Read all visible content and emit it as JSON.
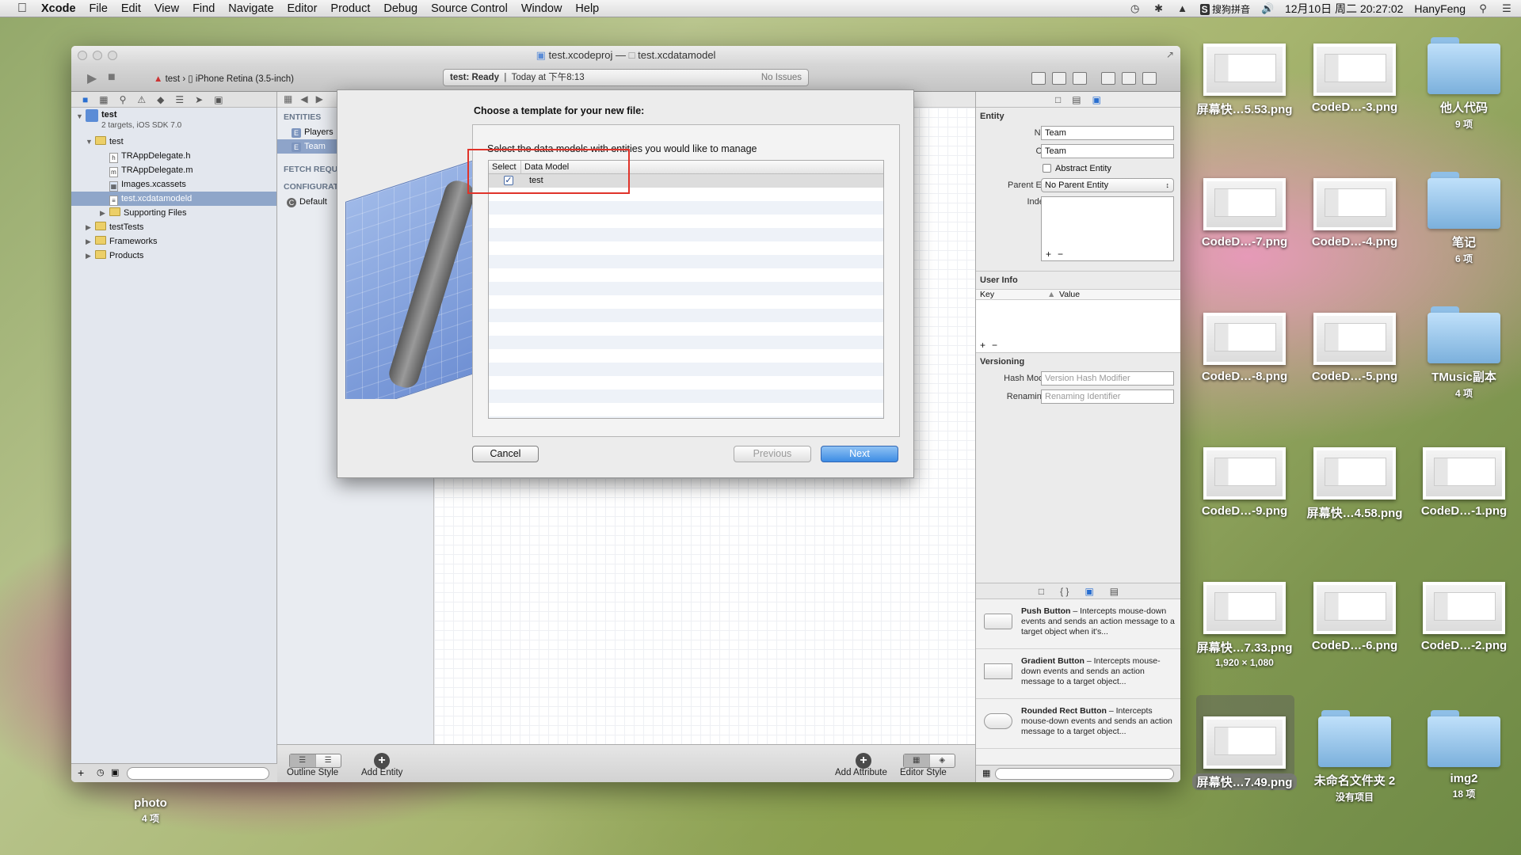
{
  "menubar": {
    "app": "Xcode",
    "items": [
      "File",
      "Edit",
      "View",
      "Find",
      "Navigate",
      "Editor",
      "Product",
      "Debug",
      "Source Control",
      "Window",
      "Help"
    ],
    "input_method": "搜狗拼音",
    "datetime": "12月10日 周二  20:27:02",
    "user": "HanyFeng"
  },
  "window": {
    "title_left": "test.xcodeproj",
    "title_sep": "—",
    "title_right": "test.xcdatamodel",
    "scheme": "test",
    "device": "iPhone Retina (3.5-inch)",
    "activity_status": "test: Ready",
    "activity_time": "Today at 下午8:13",
    "activity_issues": "No Issues"
  },
  "navigator": {
    "items": [
      {
        "label": "test",
        "sub": "2 targets, iOS SDK 7.0"
      },
      {
        "label": "test"
      },
      {
        "label": "TRAppDelegate.h"
      },
      {
        "label": "TRAppDelegate.m"
      },
      {
        "label": "Images.xcassets"
      },
      {
        "label": "test.xcdatamodeld"
      },
      {
        "label": "Supporting Files"
      },
      {
        "label": "testTests"
      },
      {
        "label": "Frameworks"
      },
      {
        "label": "Products"
      }
    ]
  },
  "outline": {
    "entities_header": "ENTITIES",
    "entities": [
      "Players",
      "Team"
    ],
    "fetch_header": "FETCH REQUESTS",
    "config_header": "CONFIGURATIONS",
    "configs": [
      "Default"
    ]
  },
  "editor_bottom": {
    "outline_style": "Outline Style",
    "add_entity": "Add Entity",
    "add_attribute": "Add Attribute",
    "editor_style": "Editor Style"
  },
  "sheet": {
    "title": "Choose a template for your new file:",
    "description": "Select the data models with entities you would like to manage",
    "col_select": "Select",
    "col_model": "Data Model",
    "rows": [
      {
        "model": "test",
        "checked": true
      }
    ],
    "cancel": "Cancel",
    "previous": "Previous",
    "next": "Next"
  },
  "inspector": {
    "entity_header": "Entity",
    "name_label": "Name",
    "name_value": "Team",
    "class_label": "Class",
    "class_value": "Team",
    "abstract_label": "Abstract Entity",
    "parent_label": "Parent Entity",
    "parent_value": "No Parent Entity",
    "indexes_label": "Indexes",
    "userinfo_header": "User Info",
    "key_col": "Key",
    "value_col": "Value",
    "versioning_header": "Versioning",
    "hash_label": "Hash Modifier",
    "hash_placeholder": "Version Hash Modifier",
    "renaming_label": "Renaming ID",
    "renaming_placeholder": "Renaming Identifier"
  },
  "library": {
    "items": [
      {
        "name": "Push Button",
        "desc": " – Intercepts mouse-down events and sends an action message to a target object when it's..."
      },
      {
        "name": "Gradient Button",
        "desc": " – Intercepts mouse-down events and sends an action message to a target object..."
      },
      {
        "name": "Rounded Rect Button",
        "desc": " – Intercepts mouse-down events and sends an action message to a target object..."
      }
    ]
  },
  "desktop": {
    "icons": [
      {
        "label": "屏幕快…5.53.png"
      },
      {
        "label": "CodeD…-3.png"
      },
      {
        "label": "他人代码",
        "sub": "9 项"
      },
      {
        "label": "CodeD…-7.png"
      },
      {
        "label": "CodeD…-4.png"
      },
      {
        "label": "笔记",
        "sub": "6 项"
      },
      {
        "label": "CodeD…-8.png"
      },
      {
        "label": "CodeD…-5.png"
      },
      {
        "label": "TMusic副本",
        "sub": "4 项"
      },
      {
        "label": "CodeD…-9.png"
      },
      {
        "label": "屏幕快…4.58.png"
      },
      {
        "label": "CodeD…-1.png"
      },
      {
        "label": "屏幕快…7.33.png",
        "sub": "1,920 × 1,080"
      },
      {
        "label": "CodeD…-6.png"
      },
      {
        "label": "CodeD…-2.png"
      },
      {
        "label": "屏幕快…7.49.png"
      },
      {
        "label": "未命名文件夹 2",
        "sub": "没有项目"
      },
      {
        "label": "img2",
        "sub": "18 项"
      },
      {
        "label": "photo",
        "sub": "4 项"
      }
    ]
  }
}
